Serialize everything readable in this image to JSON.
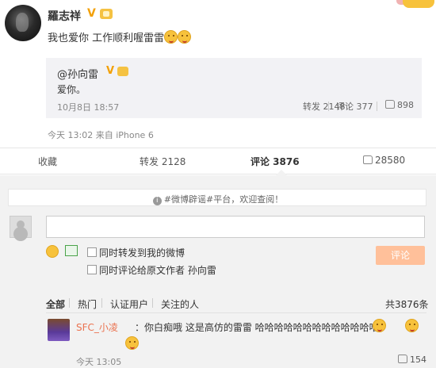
{
  "post": {
    "username": "羅志祥",
    "text": "我也爱你 工作顺利喔雷雷",
    "meta": "今天 13:02 来自 iPhone 6"
  },
  "quote": {
    "user": "@孙向雷",
    "text": "爱你。",
    "date": "10月8日 18:57",
    "repost": "转发 2148",
    "comment": "评论 377",
    "likes": "898"
  },
  "actions": {
    "favorite": "收藏",
    "repost": "转发 2128",
    "comment": "评论 3876",
    "likes": "28580"
  },
  "comment_panel": {
    "notice": "#微博辟谣#平台，欢迎查阅！",
    "repost_option": "同时转发到我的微博",
    "comment_original_option": "同时评论给原文作者 孙向雷",
    "submit_label": "评论"
  },
  "filters": {
    "tabs": [
      "全部",
      "热门",
      "认证用户",
      "关注的人"
    ],
    "count": "共3876条"
  },
  "comment": {
    "user": "SFC_小凌",
    "text": "：你白痴哦 这是高仿的雷雷 哈哈哈哈哈哈哈哈哈哈哈哈哈",
    "time": "今天 13:05",
    "likes": "154"
  },
  "colors": {
    "accent": "#eb7350",
    "submit_disabled": "#ffc09a",
    "badge": "#f2a007",
    "panel_bg": "#f2f2f2"
  }
}
